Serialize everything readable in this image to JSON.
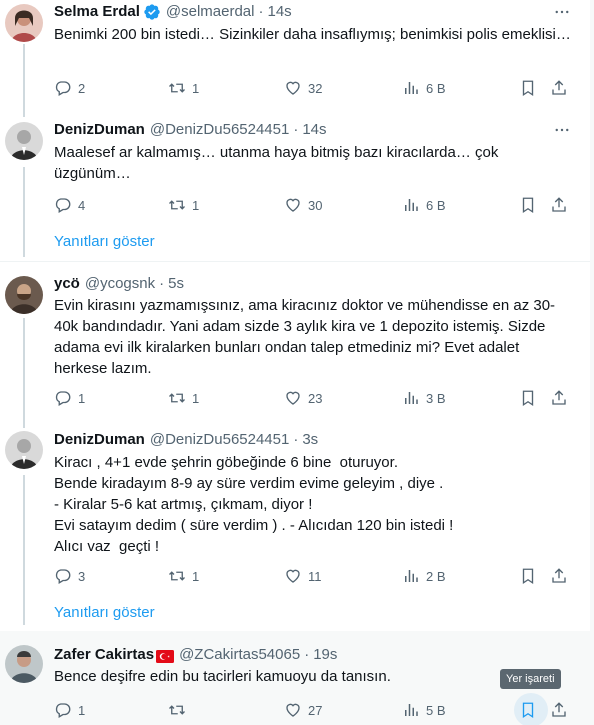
{
  "tweets": [
    {
      "name": "Selma Erdal",
      "handle": "@selmaerdal",
      "time": "14s",
      "verified": true,
      "text": "Benimki 200 bin istedi… Sizinkiler daha insaflıymış; benimkisi polis emeklisi…",
      "replies": "2",
      "retweets": "1",
      "likes": "32",
      "views": "6 B"
    },
    {
      "name": "DenizDuman",
      "handle": "@DenizDu56524451",
      "time": "14s",
      "verified": false,
      "text": "Maalesef ar kalmamış… utanma haya bitmiş bazı kiracılarda… çok üzgünüm…",
      "replies": "4",
      "retweets": "1",
      "likes": "30",
      "views": "6 B"
    },
    {
      "name": "ycö",
      "handle": "@ycogsnk",
      "time": "5s",
      "verified": false,
      "text": "Evin kirasını yazmamışsınız, ama kiracınız doktor ve mühendisse en az 30-40k bandındadır. Yani adam sizde 3 aylık kira ve 1 depozito istemiş. Sizde adama evi ilk kiralarken bunları ondan talep etmediniz mi? Evet adalet herkese lazım.",
      "replies": "1",
      "retweets": "1",
      "likes": "23",
      "views": "3 B"
    },
    {
      "name": "DenizDuman",
      "handle": "@DenizDu56524451",
      "time": "3s",
      "verified": false,
      "text": "Kiracı , 4+1 evde şehrin göbeğinde 6 bine  oturuyor.\nBende kiradayım 8-9 ay süre verdim evime geleyim , diye .\n- Kiralar 5-6 kat artmış, çıkmam, diyor !\nEvi satayım dedim ( süre verdim ) . - Alıcıdan 120 bin istedi !\nAlıcı vaz  geçti !",
      "replies": "3",
      "retweets": "1",
      "likes": "11",
      "views": "2 B"
    },
    {
      "name": "Zafer Cakirtas",
      "handle": "@ZCakirtas54065",
      "time": "19s",
      "verified": false,
      "flag": true,
      "text": "Bence deşifre edin bu tacirleri kamuoyu da tanısın.",
      "replies": "1",
      "retweets": "",
      "likes": "27",
      "views": "5 B"
    }
  ],
  "show_replies_label": "Yanıtları göster",
  "bookmark_tooltip": "Yer işareti",
  "icons": {
    "reply": "reply-icon",
    "retweet": "retweet-icon",
    "like": "heart-icon",
    "views": "views-icon",
    "bookmark": "bookmark-icon",
    "share": "share-icon",
    "more": "more-icon",
    "verified": "verified-badge-icon",
    "flag": "turkey-flag-icon"
  },
  "colors": {
    "link": "#1d9bf0",
    "muted": "#536471",
    "verified": "#1d9bf0",
    "thread_line": "#cfd9de"
  }
}
